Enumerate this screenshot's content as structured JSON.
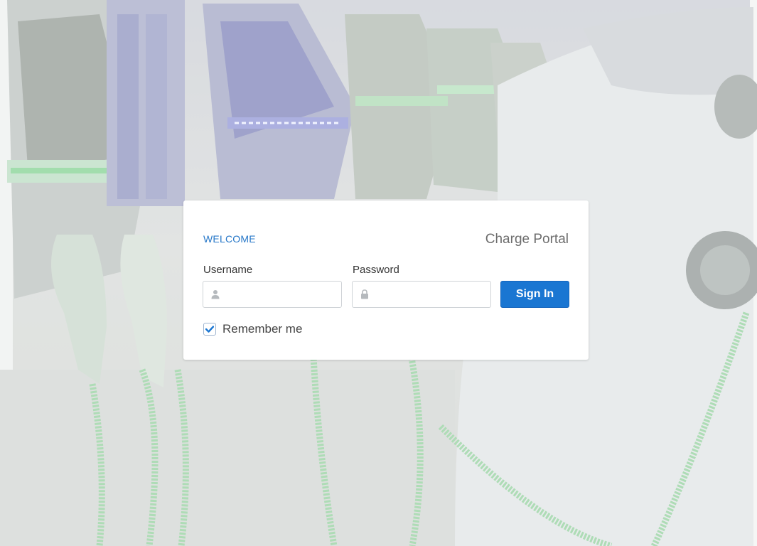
{
  "background": {
    "description_icon": "ev-charging-station-background"
  },
  "login": {
    "welcome": "WELCOME",
    "portal_title": "Charge Portal",
    "username_label": "Username",
    "username_value": "",
    "username_icon": "user-icon",
    "password_label": "Password",
    "password_value": "",
    "password_icon": "lock-icon",
    "sign_in_label": "Sign In",
    "remember_label": "Remember me",
    "remember_checked": true
  },
  "colors": {
    "accent": "#1a76d2",
    "welcome_text": "#2677c8",
    "card": "#ffffff"
  }
}
